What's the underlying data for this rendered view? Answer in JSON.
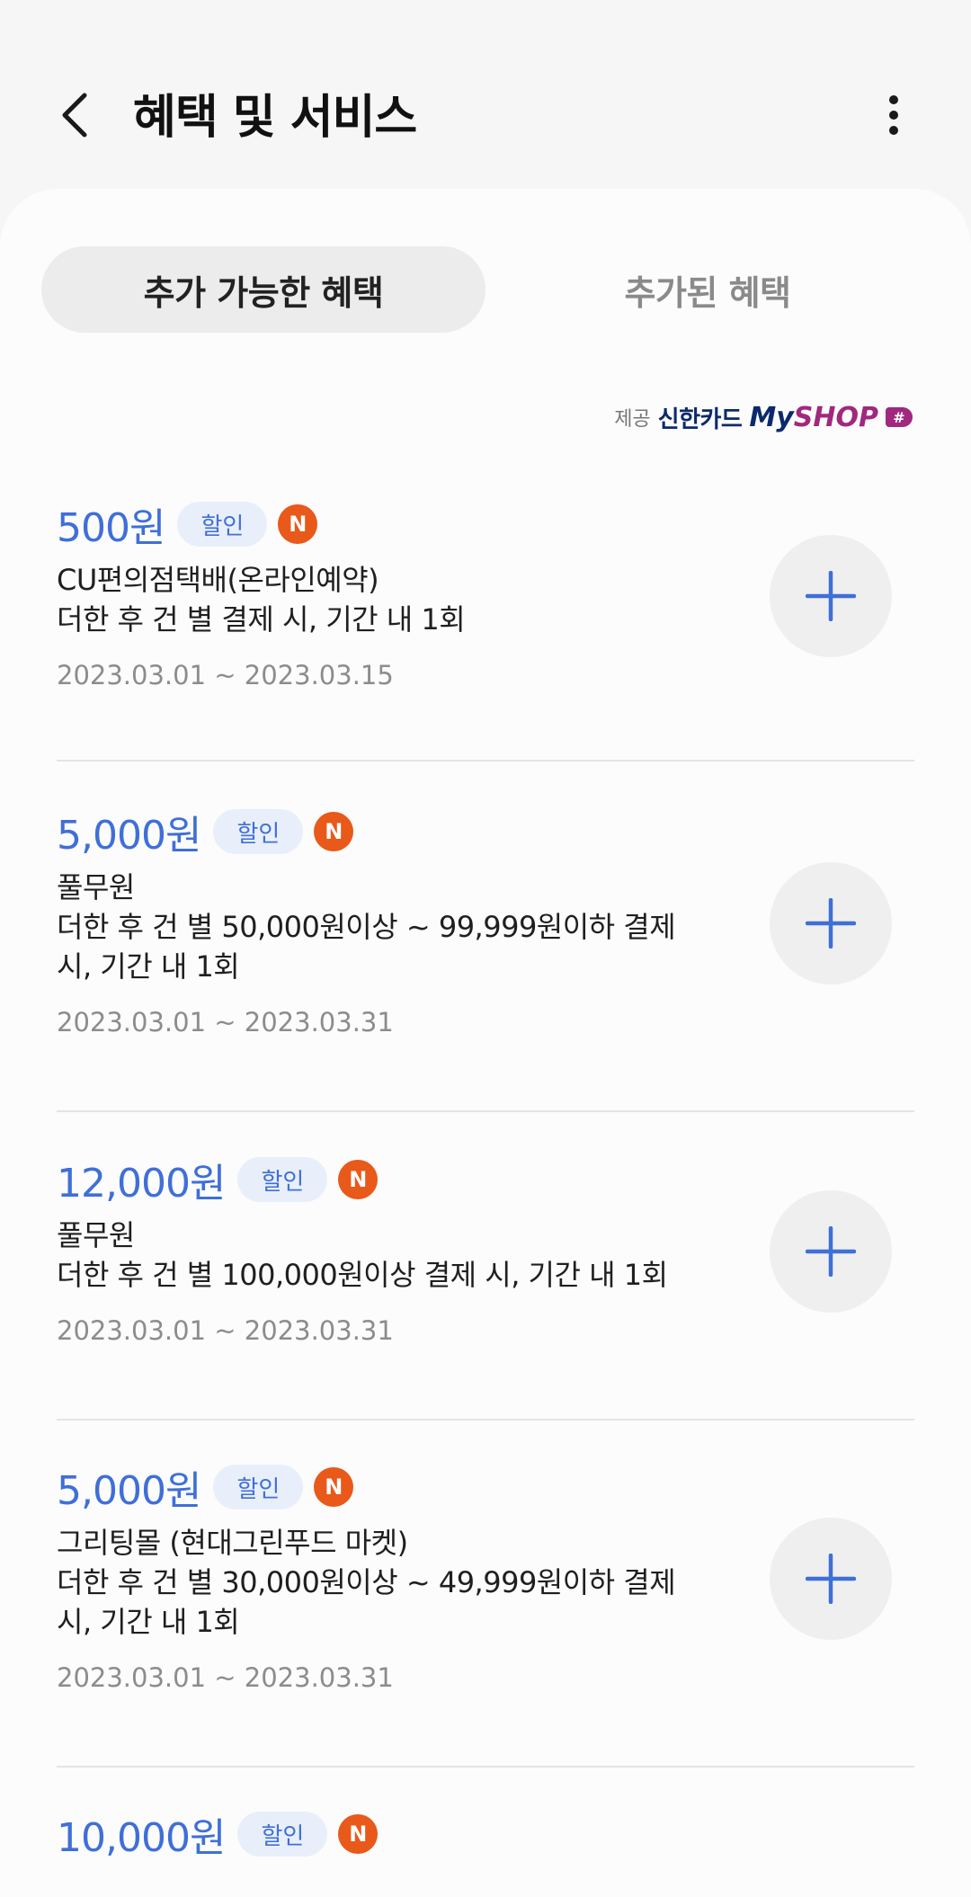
{
  "header": {
    "title": "혜택 및 서비스",
    "back_icon": "chevron-left-icon",
    "more_icon": "more-vertical-icon"
  },
  "tabs": [
    {
      "label": "추가 가능한 혜택",
      "active": true
    },
    {
      "label": "추가된 혜택",
      "active": false
    }
  ],
  "provider": {
    "label": "제공",
    "brand_card": "신한카드",
    "brand_my": "My",
    "brand_shop": "SHOP",
    "brand_badge": "#"
  },
  "benefits": [
    {
      "amount": "500원",
      "tag": "할인",
      "badge": "N",
      "merchant": "CU편의점택배(온라인예약)",
      "condition": "더한 후 건 별 결제 시, 기간 내 1회",
      "period": "2023.03.01 ~ 2023.03.15"
    },
    {
      "amount": "5,000원",
      "tag": "할인",
      "badge": "N",
      "merchant": "풀무원",
      "condition": "더한 후 건 별 50,000원이상 ~ 99,999원이하 결제 시, 기간 내 1회",
      "period": "2023.03.01 ~ 2023.03.31"
    },
    {
      "amount": "12,000원",
      "tag": "할인",
      "badge": "N",
      "merchant": "풀무원",
      "condition": "더한 후 건 별 100,000원이상 결제 시, 기간 내 1회",
      "period": "2023.03.01 ~ 2023.03.31"
    },
    {
      "amount": "5,000원",
      "tag": "할인",
      "badge": "N",
      "merchant": "그리팅몰 (현대그린푸드 마켓)",
      "condition": "더한 후 건 별 30,000원이상 ~ 49,999원이하 결제 시, 기간 내 1회",
      "period": "2023.03.01 ~ 2023.03.31"
    },
    {
      "amount": "10,000원",
      "tag": "할인",
      "badge": "N"
    }
  ],
  "colors": {
    "accent": "#3f6fd8",
    "badge": "#e8591a",
    "brand_navy": "#0c2a6b",
    "brand_purple": "#a0287f"
  }
}
